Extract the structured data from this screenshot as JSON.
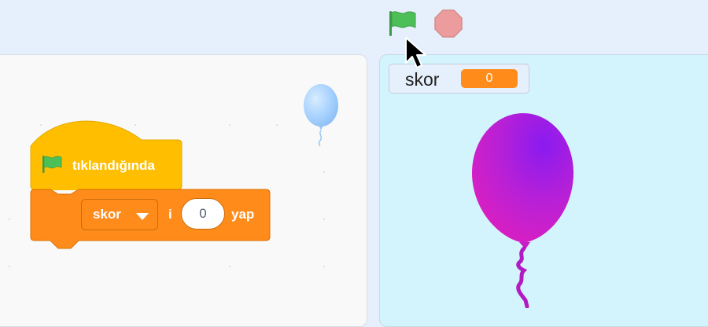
{
  "toolbar": {
    "green_flag_icon": "green-flag-icon",
    "stop_icon": "stop-sign-icon",
    "green_flag_color": "#4cbf56",
    "stop_color": "#ec9c9c"
  },
  "script_area": {
    "sprite_icon": "balloon-sprite-icon",
    "hat_block": {
      "icon": "green-flag-icon",
      "label": "tıklandığında",
      "color": "#ffbf00"
    },
    "set_block": {
      "variable": "skor",
      "connector": "i",
      "value": "0",
      "suffix": "yap",
      "color": "#ff8c1a"
    }
  },
  "stage": {
    "monitor": {
      "label": "skor",
      "value": "0"
    },
    "sprite_icon": "balloon-icon",
    "background": "#d3f4fc"
  }
}
